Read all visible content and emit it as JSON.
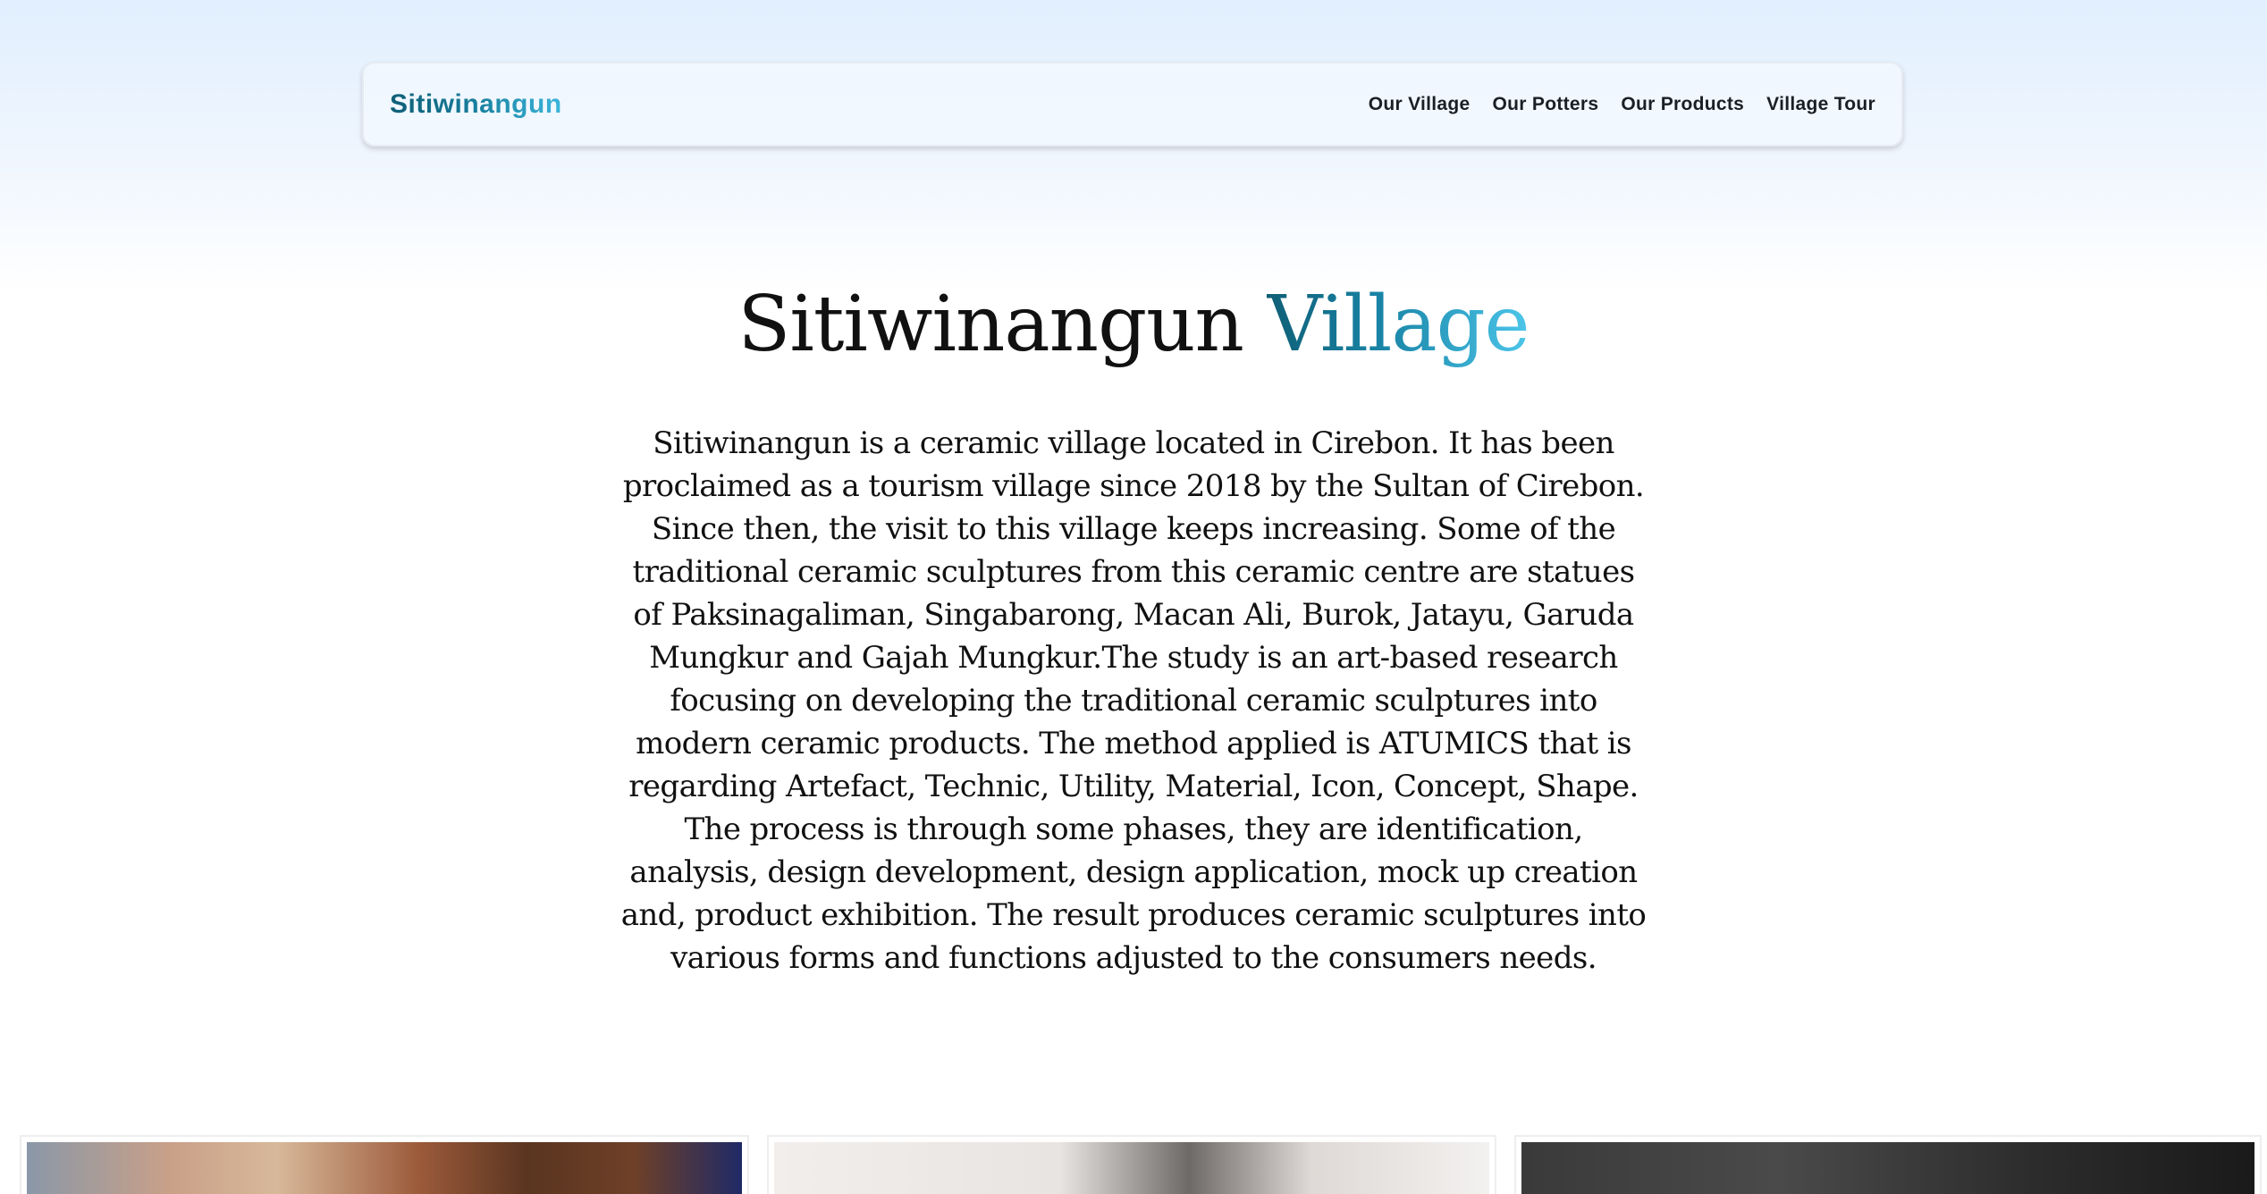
{
  "nav": {
    "brand": "Sitiwinangun",
    "links": [
      "Our Village",
      "Our Potters",
      "Our Products",
      "Village Tour"
    ]
  },
  "hero": {
    "title_main": "Sitiwinangun",
    "title_accent": "Village",
    "description": "Sitiwinangun is a ceramic village located in Cirebon. It has been proclaimed as a tourism village since 2018 by the Sultan of Cirebon. Since then, the visit to this village keeps increasing. Some of the traditional ceramic sculptures from this ceramic centre are statues of Paksinagaliman, Singabarong, Macan Ali, Burok, Jatayu, Garuda Mungkur and Gajah Mungkur.The study is an art-based research focusing on developing the traditional ceramic sculptures into modern ceramic products. The method applied is ATUMICS that is regarding Artefact, Technic, Utility, Material, Icon, Concept, Shape. The process is through some phases, they are identification, analysis, design development, design application, mock up creation and, product exhibition. The result produces ceramic sculptures into various forms and functions adjusted to the consumers needs."
  },
  "colors": {
    "brand_gradient_start": "#0f5f76",
    "brand_gradient_end": "#3bb6dc",
    "page_top_tint": "#e1effe"
  }
}
